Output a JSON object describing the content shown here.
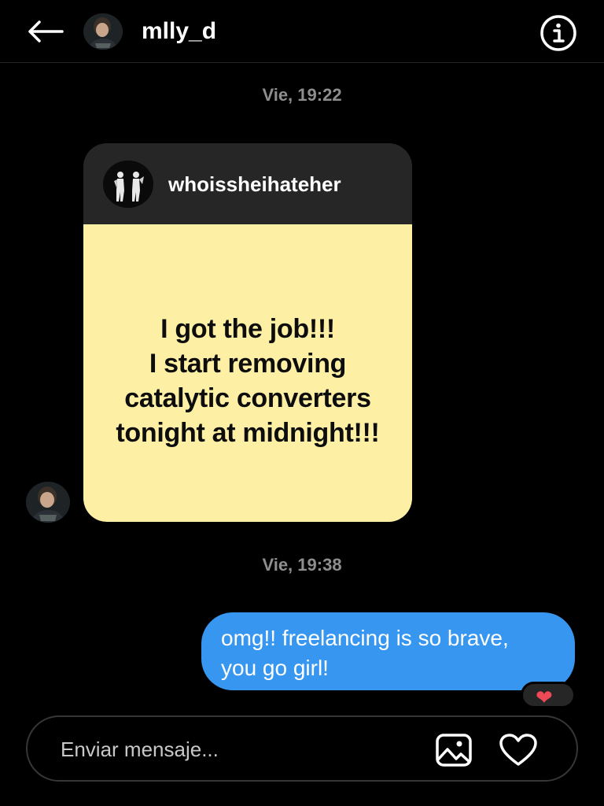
{
  "header": {
    "username": "mlly_d",
    "back_icon": "arrow-left-icon",
    "info_icon": "info-circle-icon"
  },
  "thread": {
    "timestamp_1": "Vie, 19:22",
    "shared_post": {
      "author": "whoissheihateher",
      "text_lines": [
        "I got the job!!!",
        "I start removing",
        "catalytic converters",
        "tonight at midnight!!!"
      ],
      "background_color": "#fdf0a5"
    },
    "timestamp_2": "Vie, 19:38",
    "outgoing_message": {
      "lines": [
        "omg!! freelancing is so brave,",
        "you go girl!"
      ],
      "bubble_color": "#3797f0",
      "reaction_icon": "heart-icon"
    }
  },
  "composer": {
    "placeholder": "Enviar mensaje...",
    "value": "",
    "gallery_icon": "image-icon",
    "like_icon": "heart-outline-icon"
  }
}
